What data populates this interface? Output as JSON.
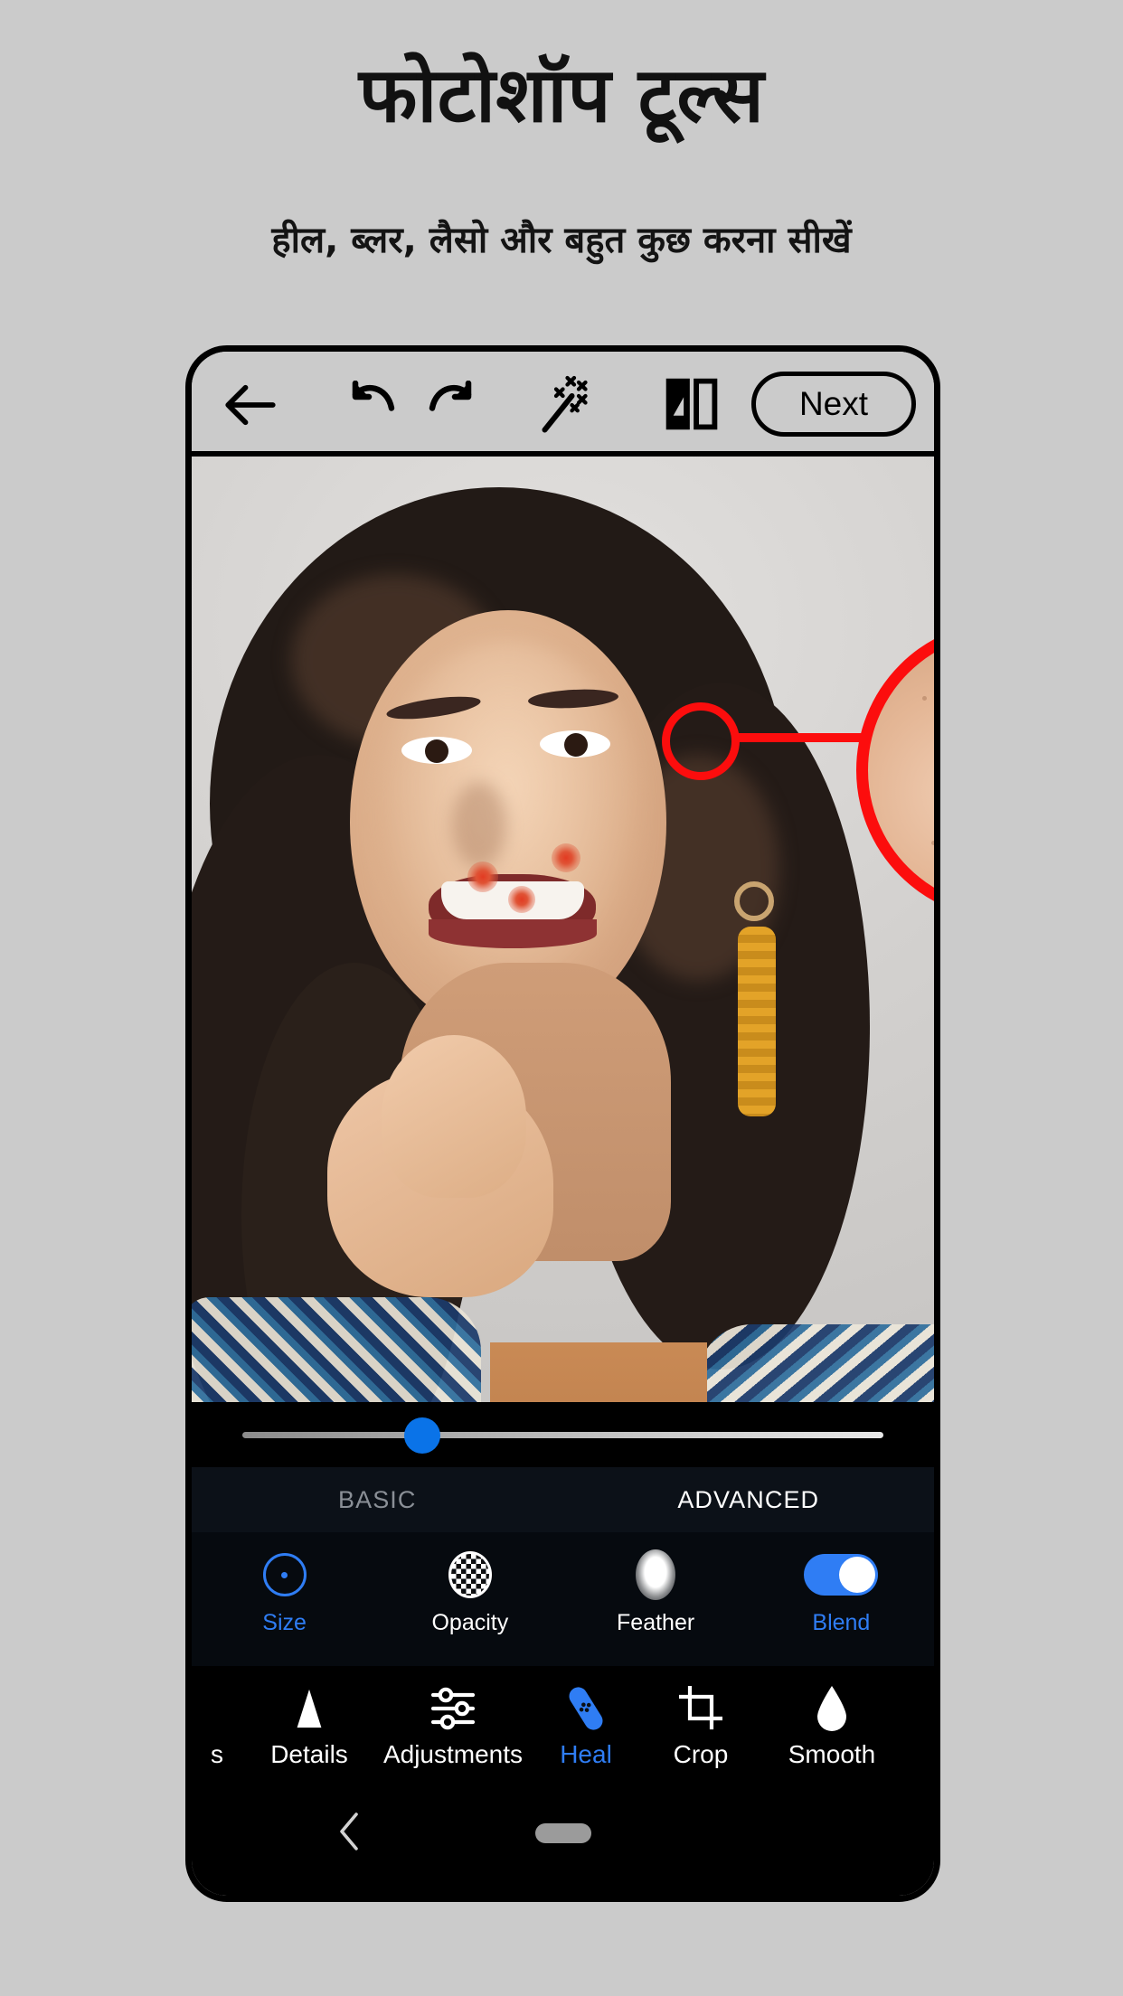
{
  "promo": {
    "title": "फोटोशॉप टूल्स",
    "subtitle": "हील, ब्लर, लैसो और बहुत कुछ करना सीखें"
  },
  "app_toolbar": {
    "back_icon": "arrow-left-icon",
    "undo_icon": "undo-icon",
    "redo_icon": "redo-icon",
    "wand_icon": "magic-wand-icon",
    "compare_icon": "before-after-compare-icon",
    "next_label": "Next"
  },
  "photo": {
    "callout_label": "skin-texture-magnifier",
    "accent_color": "#fc0d0d"
  },
  "slider": {
    "name": "brush-size-slider",
    "value_percent": 28
  },
  "tabs": [
    {
      "label": "BASIC",
      "active": false
    },
    {
      "label": "ADVANCED",
      "active": true
    }
  ],
  "params": [
    {
      "label": "Size",
      "icon": "brush-size-circle-icon",
      "active": true
    },
    {
      "label": "Opacity",
      "icon": "checkerboard-circle-icon",
      "active": false
    },
    {
      "label": "Feather",
      "icon": "soft-blob-icon",
      "active": false
    },
    {
      "label": "Blend",
      "icon": "toggle-switch-icon",
      "active": true
    }
  ],
  "blend_toggle": {
    "state": "on",
    "color": "#2f7df4"
  },
  "tools": [
    {
      "label": "s",
      "icon": "clipped-tool-icon",
      "active": false
    },
    {
      "label": "Details",
      "icon": "triangle-icon",
      "active": false
    },
    {
      "label": "Adjustments",
      "icon": "sliders-icon",
      "active": false
    },
    {
      "label": "Heal",
      "icon": "bandage-icon",
      "active": true
    },
    {
      "label": "Crop",
      "icon": "crop-icon",
      "active": false
    },
    {
      "label": "Smooth",
      "icon": "droplet-icon",
      "active": false
    }
  ],
  "nav": {
    "back_icon": "chevron-left-icon",
    "home_icon": "home-pill-icon"
  },
  "colors": {
    "background": "#cbcbcb",
    "accent_blue": "#2f7df4",
    "accent_red": "#fc0d0d",
    "panel_dark": "#060a0f",
    "tab_panel": "#0c1118"
  }
}
